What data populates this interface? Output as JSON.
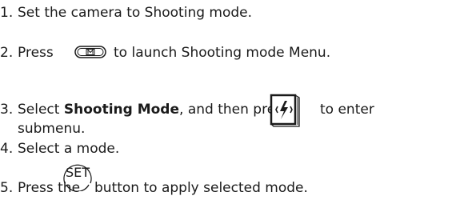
{
  "steps": [
    {
      "num": "1.",
      "text": "Set the camera to Shooting mode."
    },
    {
      "num": "2.",
      "text_before": "Press",
      "text_after": "to launch Shooting mode Menu."
    },
    {
      "num": "3.",
      "text_before": "Select",
      "bold": "Shooting Mode",
      "text_mid": ", and then press",
      "text_after": "to enter",
      "text_wrap": "submenu."
    },
    {
      "num": "4.",
      "text": "Select a mode."
    },
    {
      "num": "5.",
      "text_before": "Press the",
      "text_after": "button to apply selected mode."
    }
  ],
  "icons": {
    "menu_button": "menu-button-icon",
    "flash_button": "flash-button-icon",
    "set_button": "set-button-icon",
    "set_label": "SET"
  },
  "colors": {
    "text": "#1a1a1a"
  }
}
